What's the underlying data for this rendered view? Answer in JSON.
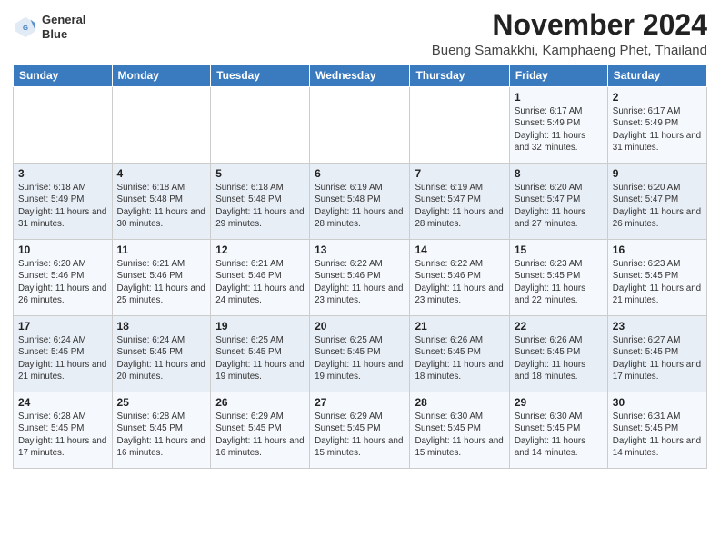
{
  "header": {
    "logo_line1": "General",
    "logo_line2": "Blue",
    "title": "November 2024",
    "subtitle": "Bueng Samakkhi, Kamphaeng Phet, Thailand"
  },
  "days_of_week": [
    "Sunday",
    "Monday",
    "Tuesday",
    "Wednesday",
    "Thursday",
    "Friday",
    "Saturday"
  ],
  "weeks": [
    [
      {
        "day": "",
        "info": ""
      },
      {
        "day": "",
        "info": ""
      },
      {
        "day": "",
        "info": ""
      },
      {
        "day": "",
        "info": ""
      },
      {
        "day": "",
        "info": ""
      },
      {
        "day": "1",
        "info": "Sunrise: 6:17 AM\nSunset: 5:49 PM\nDaylight: 11 hours and 32 minutes."
      },
      {
        "day": "2",
        "info": "Sunrise: 6:17 AM\nSunset: 5:49 PM\nDaylight: 11 hours and 31 minutes."
      }
    ],
    [
      {
        "day": "3",
        "info": "Sunrise: 6:18 AM\nSunset: 5:49 PM\nDaylight: 11 hours and 31 minutes."
      },
      {
        "day": "4",
        "info": "Sunrise: 6:18 AM\nSunset: 5:48 PM\nDaylight: 11 hours and 30 minutes."
      },
      {
        "day": "5",
        "info": "Sunrise: 6:18 AM\nSunset: 5:48 PM\nDaylight: 11 hours and 29 minutes."
      },
      {
        "day": "6",
        "info": "Sunrise: 6:19 AM\nSunset: 5:48 PM\nDaylight: 11 hours and 28 minutes."
      },
      {
        "day": "7",
        "info": "Sunrise: 6:19 AM\nSunset: 5:47 PM\nDaylight: 11 hours and 28 minutes."
      },
      {
        "day": "8",
        "info": "Sunrise: 6:20 AM\nSunset: 5:47 PM\nDaylight: 11 hours and 27 minutes."
      },
      {
        "day": "9",
        "info": "Sunrise: 6:20 AM\nSunset: 5:47 PM\nDaylight: 11 hours and 26 minutes."
      }
    ],
    [
      {
        "day": "10",
        "info": "Sunrise: 6:20 AM\nSunset: 5:46 PM\nDaylight: 11 hours and 26 minutes."
      },
      {
        "day": "11",
        "info": "Sunrise: 6:21 AM\nSunset: 5:46 PM\nDaylight: 11 hours and 25 minutes."
      },
      {
        "day": "12",
        "info": "Sunrise: 6:21 AM\nSunset: 5:46 PM\nDaylight: 11 hours and 24 minutes."
      },
      {
        "day": "13",
        "info": "Sunrise: 6:22 AM\nSunset: 5:46 PM\nDaylight: 11 hours and 23 minutes."
      },
      {
        "day": "14",
        "info": "Sunrise: 6:22 AM\nSunset: 5:46 PM\nDaylight: 11 hours and 23 minutes."
      },
      {
        "day": "15",
        "info": "Sunrise: 6:23 AM\nSunset: 5:45 PM\nDaylight: 11 hours and 22 minutes."
      },
      {
        "day": "16",
        "info": "Sunrise: 6:23 AM\nSunset: 5:45 PM\nDaylight: 11 hours and 21 minutes."
      }
    ],
    [
      {
        "day": "17",
        "info": "Sunrise: 6:24 AM\nSunset: 5:45 PM\nDaylight: 11 hours and 21 minutes."
      },
      {
        "day": "18",
        "info": "Sunrise: 6:24 AM\nSunset: 5:45 PM\nDaylight: 11 hours and 20 minutes."
      },
      {
        "day": "19",
        "info": "Sunrise: 6:25 AM\nSunset: 5:45 PM\nDaylight: 11 hours and 19 minutes."
      },
      {
        "day": "20",
        "info": "Sunrise: 6:25 AM\nSunset: 5:45 PM\nDaylight: 11 hours and 19 minutes."
      },
      {
        "day": "21",
        "info": "Sunrise: 6:26 AM\nSunset: 5:45 PM\nDaylight: 11 hours and 18 minutes."
      },
      {
        "day": "22",
        "info": "Sunrise: 6:26 AM\nSunset: 5:45 PM\nDaylight: 11 hours and 18 minutes."
      },
      {
        "day": "23",
        "info": "Sunrise: 6:27 AM\nSunset: 5:45 PM\nDaylight: 11 hours and 17 minutes."
      }
    ],
    [
      {
        "day": "24",
        "info": "Sunrise: 6:28 AM\nSunset: 5:45 PM\nDaylight: 11 hours and 17 minutes."
      },
      {
        "day": "25",
        "info": "Sunrise: 6:28 AM\nSunset: 5:45 PM\nDaylight: 11 hours and 16 minutes."
      },
      {
        "day": "26",
        "info": "Sunrise: 6:29 AM\nSunset: 5:45 PM\nDaylight: 11 hours and 16 minutes."
      },
      {
        "day": "27",
        "info": "Sunrise: 6:29 AM\nSunset: 5:45 PM\nDaylight: 11 hours and 15 minutes."
      },
      {
        "day": "28",
        "info": "Sunrise: 6:30 AM\nSunset: 5:45 PM\nDaylight: 11 hours and 15 minutes."
      },
      {
        "day": "29",
        "info": "Sunrise: 6:30 AM\nSunset: 5:45 PM\nDaylight: 11 hours and 14 minutes."
      },
      {
        "day": "30",
        "info": "Sunrise: 6:31 AM\nSunset: 5:45 PM\nDaylight: 11 hours and 14 minutes."
      }
    ]
  ]
}
